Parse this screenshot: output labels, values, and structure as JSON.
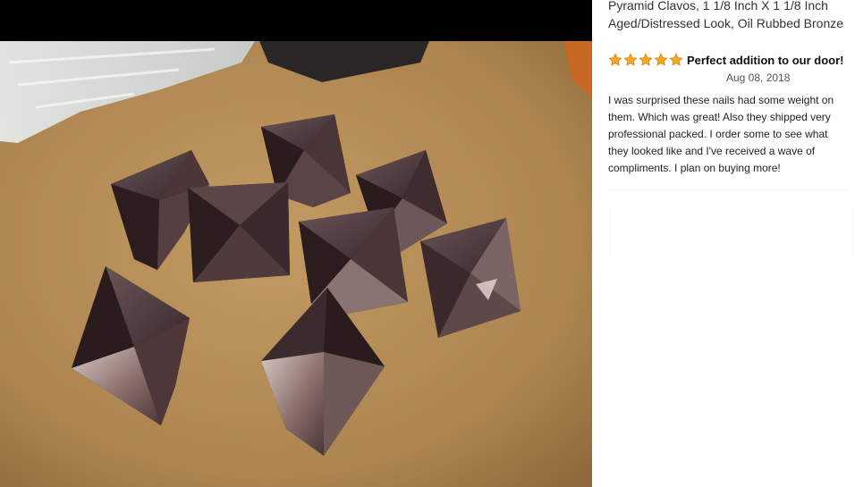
{
  "product": {
    "title_lines": [
      "Pyramid Clavos, 1 1/8 Inch X 1 1/8 Inch",
      "Aged/Distressed Look, Oil Rubbed Bronze"
    ]
  },
  "review": {
    "rating": 5,
    "rating_max": 5,
    "title": "Perfect addition to our door!",
    "date": "Aug 08, 2018",
    "body_lines": [
      "I was surprised these nails had some weight on",
      "them. Which was great! Also they shipped very",
      "professional packed. I order some to see what",
      "they looked like and I've received a wave of",
      "compliments. I plan on buying more!"
    ]
  },
  "colors": {
    "star": "#f5a623",
    "star_stroke": "#c7800f",
    "table": "#b48a52",
    "nail_bronze": "#3a2628"
  },
  "icons": {
    "star": "star-icon"
  }
}
